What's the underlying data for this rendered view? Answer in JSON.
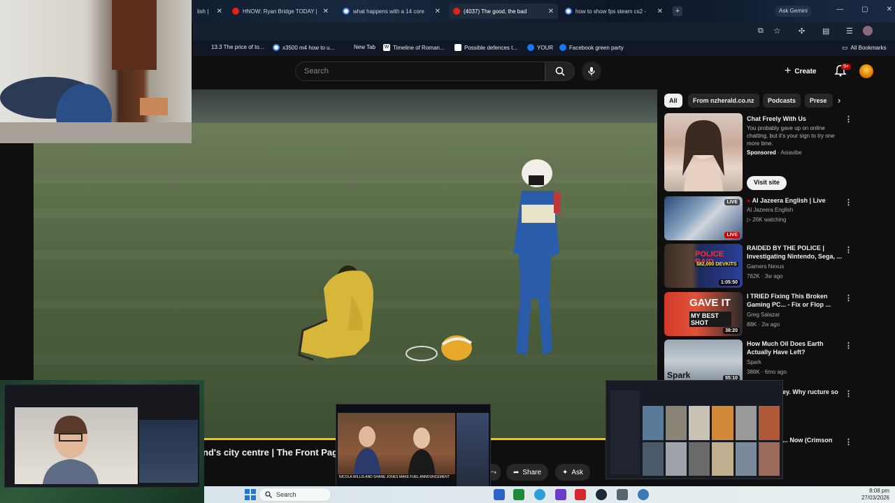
{
  "browser": {
    "tabs": [
      {
        "label": "lish |",
        "icon": "tab-favicon"
      },
      {
        "label": "HNOW: Ryan Bridge TODAY |",
        "icon": "youtube-icon"
      },
      {
        "label": "what happens with a 14 core",
        "icon": "google-icon"
      },
      {
        "label": "(4037) The good, the bad",
        "icon": "youtube-icon",
        "active": true
      },
      {
        "label": "how to show fps steam cs2 -",
        "icon": "google-icon"
      }
    ],
    "ask_gemini": "Ask Gemini",
    "bookmarks": [
      {
        "label": "13.3 The price of to..."
      },
      {
        "label": "x3500 m4 how to u..."
      },
      {
        "label": "New Tab"
      },
      {
        "label": "Timeline of Roman..."
      },
      {
        "label": "Possible defences t..."
      },
      {
        "label": "YOUR"
      },
      {
        "label": "Facebook green party"
      }
    ],
    "all_bookmarks": "All Bookmarks"
  },
  "youtube": {
    "search_placeholder": "Search",
    "create_label": "Create",
    "notification_count": "9+",
    "video_title": "nd's city centre | The Front Page",
    "share_label": "Share",
    "ask_label": "Ask",
    "chips": [
      "All",
      "From nzherald.co.nz",
      "Podcasts",
      "Prese"
    ],
    "sponsored": {
      "title": "Chat Freely With Us",
      "description": "You probably gave up on online chatting, but it's your sign to try one more time.",
      "sponsored_label": "Sponsored",
      "advertiser": "Asiavibe",
      "visit_label": "Visit site"
    },
    "recommendations": [
      {
        "title": "Al Jazeera English | Live",
        "channel": "Al Jazeera English",
        "meta": "26K watching",
        "badge": "LIVE"
      },
      {
        "title": "RAIDED BY THE POLICE | Investigating Nintendo, Sega, ...",
        "channel": "Gamers Nexus",
        "meta": "762K · 3w ago",
        "duration": "1:05:50",
        "thumb_text": "POLICE RAID",
        "thumb_sub": "$82,000 DEVKITS"
      },
      {
        "title": "I TRIED Fixing This Broken Gaming PC... - Fix or Flop ...",
        "channel": "Greg Salazar",
        "meta": "88K · 2w ago",
        "duration": "38:20",
        "thumb_text": "GAVE IT",
        "thumb_sub": "MY BEST SHOT"
      },
      {
        "title": "How Much Oil Does Earth Actually Have Left?",
        "channel": "Spark",
        "meta": "388K · 6mo ago",
        "duration": "55:10",
        "thumb_text": "Spark"
      },
      {
        "title": "ing the money. Why ructure so bad? |",
        "channel": "",
        "meta": ""
      },
      {
        "title": "HATED This... Now (Crimson Desert)",
        "channel": "",
        "meta": ""
      }
    ]
  },
  "overlays": {
    "pip_mid_caption": "NICOLA WILLIS AND SHANE JONES MAKE FUEL ANNOUNCEMENT"
  },
  "taskbar": {
    "search_label": "Search",
    "time": "8:08 pm",
    "date": "27/03/2026"
  },
  "colors": {
    "progress": "#f5c400",
    "youtube_red": "#cc0000",
    "background": "#0f0f0f"
  }
}
